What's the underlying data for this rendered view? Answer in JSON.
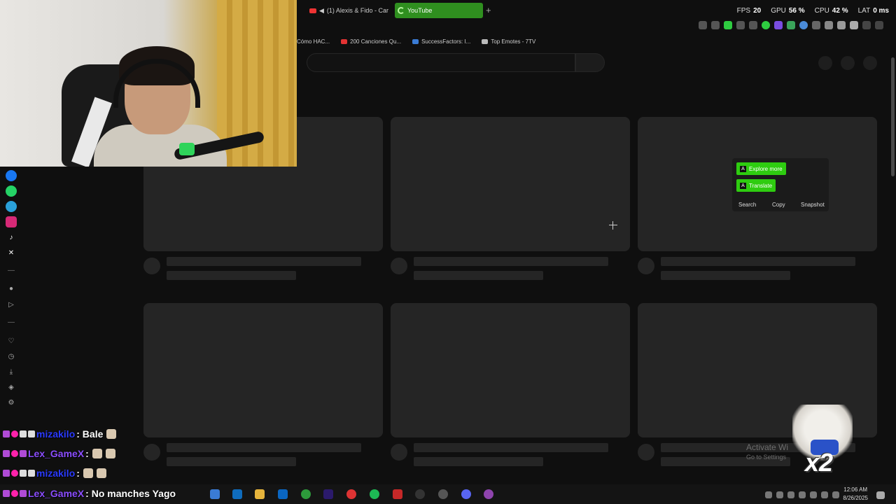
{
  "tabs": [
    {
      "label": "(1) Alexis & Fido - Car",
      "active": false
    },
    {
      "label": "YouTube",
      "active": true
    }
  ],
  "stats": {
    "fps_label": "FPS",
    "fps": "20",
    "gpu_label": "GPU",
    "gpu": "56 %",
    "cpu_label": "CPU",
    "cpu": "42 %",
    "lat_label": "LAT",
    "lat": "0 ms"
  },
  "bookmarks": [
    {
      "label": "Cómo HAC...",
      "color": "#888888"
    },
    {
      "label": "200 Canciones Qu...",
      "color": "#e33333"
    },
    {
      "label": "SuccessFactors: I...",
      "color": "#3a7bd5"
    },
    {
      "label": "Top Emotes - 7TV",
      "color": "#bbbbbb"
    }
  ],
  "popup": {
    "explore": "Explore more",
    "translate": "Translate",
    "search": "Search",
    "copy": "Copy",
    "snapshot": "Snapshot"
  },
  "sidebar_icons": [
    "messenger-icon",
    "whatsapp-icon",
    "telegram-icon",
    "instagram-icon",
    "tiktok-icon",
    "x-icon",
    "dash-icon",
    "record-icon",
    "play-icon",
    "dash-icon",
    "heart-icon",
    "history-icon",
    "download-icon",
    "extensions-icon",
    "settings-icon"
  ],
  "chat": [
    {
      "user": "mizakilo",
      "msg": ": Bale",
      "user_color": "#2a3aff"
    },
    {
      "user": "Lex_GameX",
      "msg": ":",
      "user_color": "#8b4dff"
    },
    {
      "user": "mizakilo",
      "msg": ":",
      "user_color": "#2a3aff"
    },
    {
      "user": "Lex_GameX",
      "msg": ": No manches Yago",
      "user_color": "#8b4dff"
    }
  ],
  "activate": {
    "title": "Activate Wi",
    "subtitle": "Go to Settings"
  },
  "overlay": {
    "multiplier": "x2"
  },
  "clock": {
    "time": "12:06 AM",
    "date": "8/26/2025"
  }
}
